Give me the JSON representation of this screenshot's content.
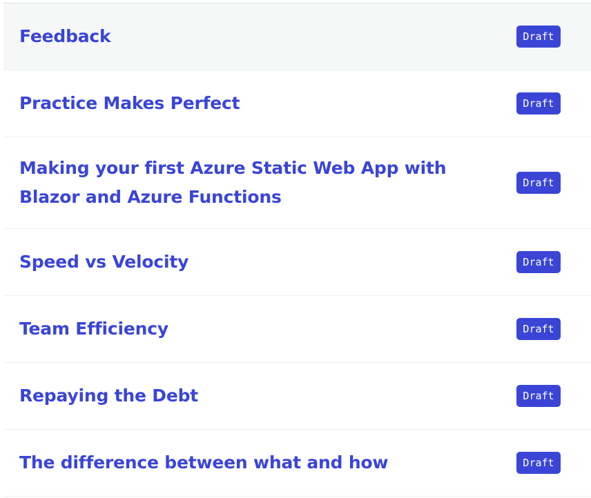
{
  "posts": [
    {
      "title": "Feedback",
      "status": "Draft"
    },
    {
      "title": "Practice Makes Perfect",
      "status": "Draft"
    },
    {
      "title": "Making your first Azure Static Web App with Blazor and Azure Functions",
      "status": "Draft"
    },
    {
      "title": "Speed vs Velocity",
      "status": "Draft"
    },
    {
      "title": "Team Efficiency",
      "status": "Draft"
    },
    {
      "title": "Repaying the Debt",
      "status": "Draft"
    },
    {
      "title": "The difference between what and how",
      "status": "Draft"
    }
  ],
  "colors": {
    "link": "#3a45d6",
    "badge_bg": "#3a45d6",
    "badge_text": "#ffffff",
    "hover_row": "#f6f8f8"
  }
}
